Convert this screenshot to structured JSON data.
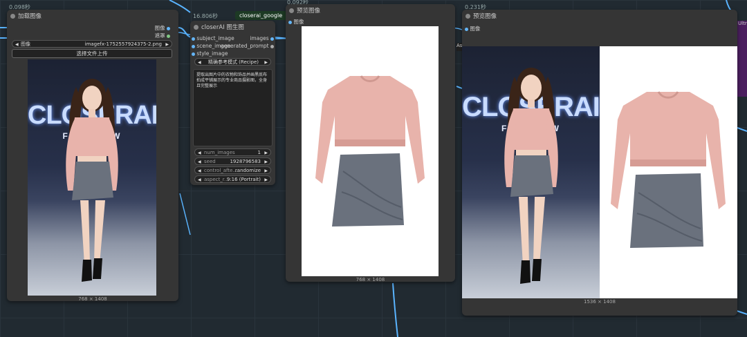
{
  "timings": {
    "load": "0.098秒",
    "gen": "16.806秒",
    "preview1": "0.092秒",
    "preview2": "0.231秒"
  },
  "load_node": {
    "title": "加载图像",
    "outputs": [
      "图像",
      "遮罩"
    ],
    "image_label": "图像",
    "image_file": "imagefx-1752557924375-2.png",
    "upload_button": "选择文件上传",
    "dims": "768 × 1408",
    "stage_text_big": "CLOSERAI",
    "stage_text_small": "FA S  SHOW"
  },
  "gen_node": {
    "badge": "closerai_google",
    "title": "closerAI 图生图",
    "inputs": [
      "subject_image",
      "scene_image",
      "style_image"
    ],
    "outputs": [
      "images",
      "generated_prompt"
    ],
    "mode": "精确参考模式 (Recipe)",
    "prompt": "提取出图片中的衣物和饰品并画黑底布拍成平铺展示的专业商品摄影图，全身且完整展示",
    "widgets": [
      {
        "label": "num_images",
        "value": "1"
      },
      {
        "label": "seed",
        "value": "1928796583"
      },
      {
        "label": "control_afte...",
        "value": "randomize"
      },
      {
        "label": "aspect_r...",
        "value": "9:16 (Portrait)"
      }
    ]
  },
  "preview1": {
    "title": "预览图像",
    "input": "图像",
    "dims": "768 × 1408"
  },
  "preview2": {
    "title": "预览图像",
    "input": "图像",
    "dims": "1536 × 1408",
    "stage_text_big": "CLOSERAI",
    "stage_text_small": "FA S  SHOW"
  },
  "partial": {
    "left_edge_tag": "As",
    "right_edge_tag": "Ultr"
  },
  "colors": {
    "wire": "#5ab4ff",
    "background": "#212a31",
    "node": "#353535",
    "badge": "#1d3a24",
    "sweater": "#e8b3ab",
    "skirt": "#6a717d"
  }
}
